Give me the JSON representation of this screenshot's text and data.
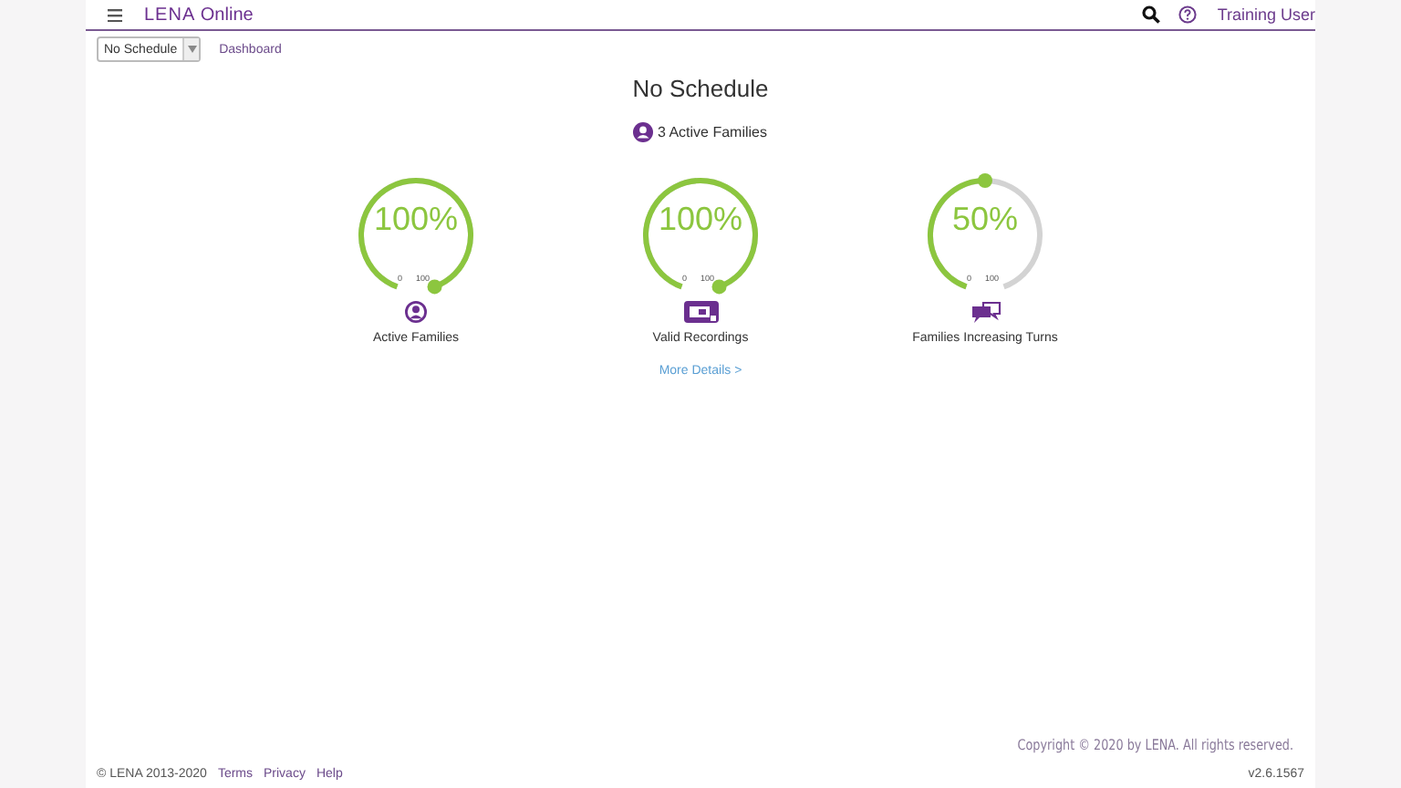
{
  "header": {
    "logo": "LENA",
    "logo_suffix": "Online",
    "user": "Training User"
  },
  "toolbar": {
    "schedule_select": "No Schedule",
    "breadcrumb": "Dashboard"
  },
  "title": "No Schedule",
  "summary": "3 Active Families",
  "gauges": [
    {
      "value": "100%",
      "min_label": "0",
      "max_label": "100",
      "kind": "families",
      "label": "Active Families"
    },
    {
      "value": "100%",
      "min_label": "0",
      "max_label": "100",
      "kind": "recordings",
      "label": "Valid Recordings"
    },
    {
      "value": "50%",
      "min_label": "0",
      "max_label": "100",
      "kind": "turns",
      "label": "Families Increasing Turns"
    }
  ],
  "more_link": "More Details >",
  "copyright": "Copyright © 2020 by LENA. All rights reserved.",
  "footer": {
    "brand": "© LENA 2013-2020",
    "links": [
      "Terms",
      "Privacy",
      "Help"
    ],
    "version": "v2.6.1567"
  }
}
